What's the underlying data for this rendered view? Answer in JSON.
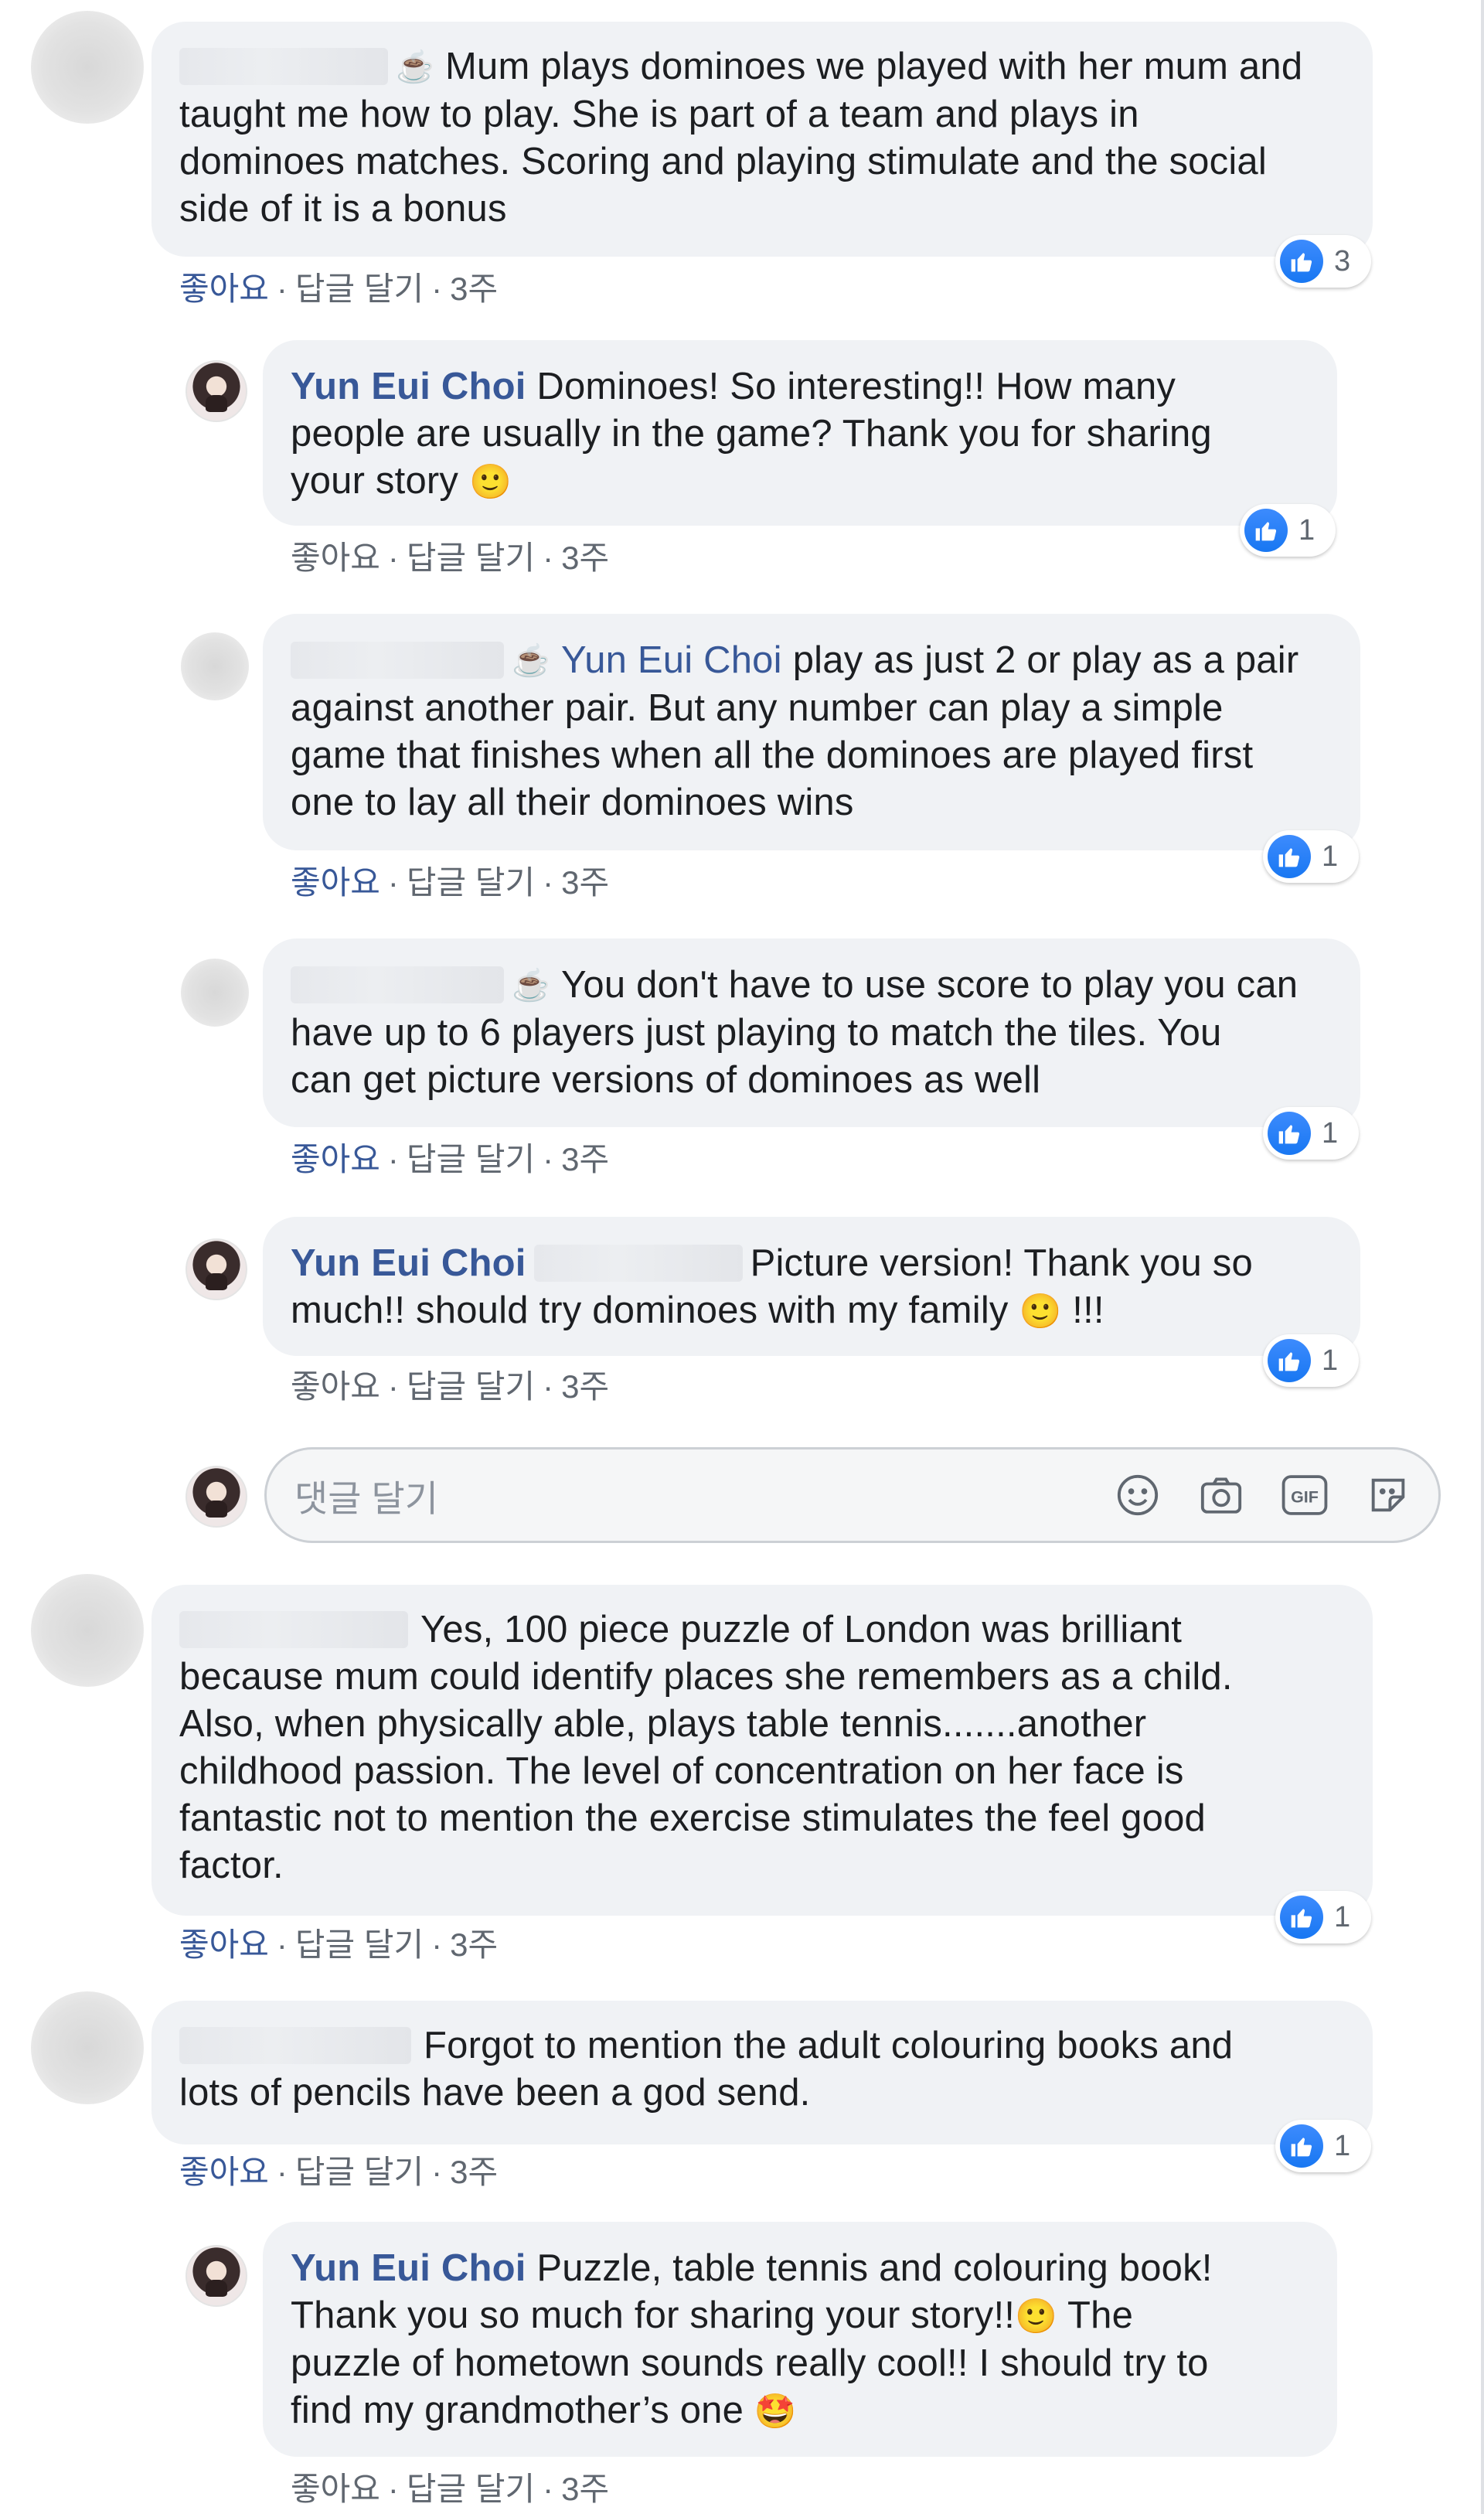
{
  "labels": {
    "like": "좋아요",
    "reply": "답글 달기",
    "time": "3주",
    "dot": "·"
  },
  "comments": [
    {
      "text": "Mum plays dominoes we played with her mum and\ntaught me how to play. She is part of a team and plays in\ndominoes matches. Scoring and playing stimulate and the social\nside of it is a bonus",
      "reactions": "3"
    },
    {
      "author": "Yun Eui Choi",
      "text": " Dominoes! So interesting!! How many\npeople are usually in the game? Thank you for sharing\nyour story ",
      "emoji": "🙂",
      "reactions": "1"
    },
    {
      "mention": "Yun Eui Choi",
      "text": "play as just 2 or play as a pair\nagainst another pair. But any number can play a simple\ngame that finishes when all the dominoes are played first\none to lay all their dominoes wins",
      "reactions": "1"
    },
    {
      "text": "You don't have to use score to play you can\nhave up to 6 players just playing to match the tiles. You\ncan get picture versions of dominoes as well",
      "reactions": "1"
    },
    {
      "author": "Yun Eui Choi",
      "text": "Picture version! Thank you so\nmuch!! should try dominoes with my family ",
      "emoji": "🙂",
      "text_after": " !!!",
      "reactions": "1"
    },
    {
      "text": "Yes, 100 piece puzzle of London was brilliant\nbecause mum could identify places she remembers as a child.\nAlso, when physically able, plays table tennis.......another\nchildhood passion. The level of concentration on her face is\nfantastic not to mention the exercise stimulates the feel good\nfactor.",
      "reactions": "1"
    },
    {
      "text": "Forgot to mention the adult colouring books and\nlots of pencils have been a god send.",
      "reactions": "1"
    },
    {
      "author": "Yun Eui Choi",
      "text": " Puzzle, table tennis and colouring book!\nThank you so much for sharing your story!!",
      "emoji": "🙂",
      "text_after": " The\npuzzle of hometown sounds really cool!! I should try to\nfind my grandmother’s one ",
      "emoji2": "🤩"
    }
  ],
  "reply_box": {
    "placeholder": "댓글 달기"
  },
  "icons": {
    "cup": "☕",
    "emoji_tool": "smiley-icon",
    "camera_tool": "camera-icon",
    "gif_tool": "gif-icon",
    "sticker_tool": "sticker-icon",
    "gif_text": "GIF"
  },
  "colors": {
    "link": "#385898",
    "bubble": "#f0f2f5",
    "like_blue": "#1877f2"
  }
}
